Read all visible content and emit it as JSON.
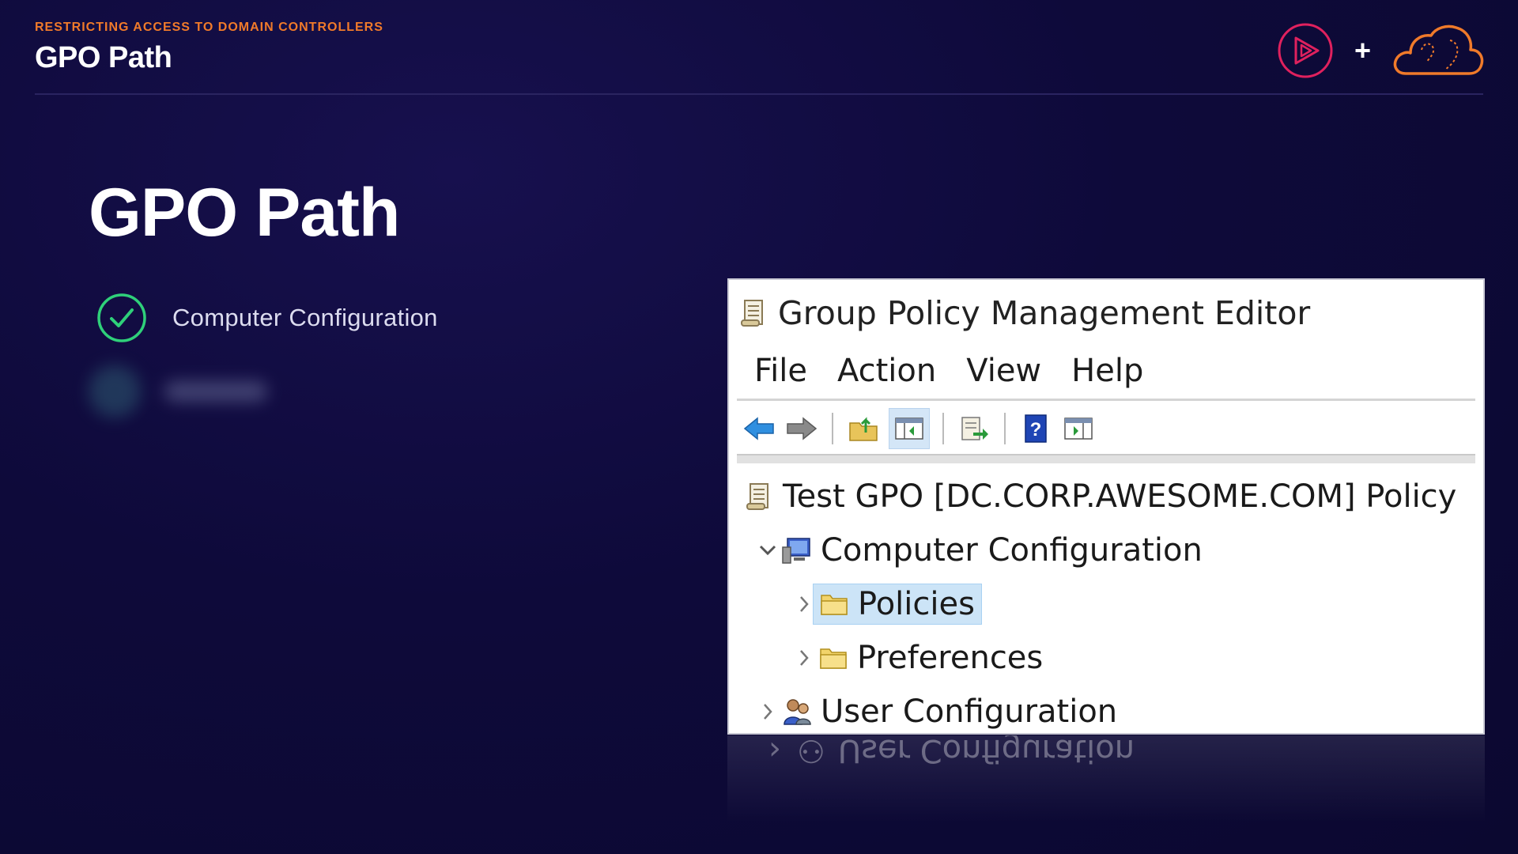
{
  "header": {
    "eyebrow": "RESTRICTING ACCESS TO DOMAIN CONTROLLERS",
    "title": "GPO Path"
  },
  "logos": {
    "left": "play-logo-icon",
    "plus": "+",
    "right": "cloud-logo-icon"
  },
  "main": {
    "title": "GPO Path",
    "bullets": [
      {
        "label": "Computer Configuration",
        "icon": "checkmark-icon",
        "state": "done"
      }
    ]
  },
  "window": {
    "title": "Group Policy Management Editor",
    "menu": [
      "File",
      "Action",
      "View",
      "Help"
    ],
    "toolbar_icons": [
      "back-arrow-icon",
      "forward-arrow-icon",
      "up-folder-icon",
      "show-hide-tree-icon",
      "export-list-icon",
      "help-icon",
      "properties-icon"
    ],
    "tree": {
      "root": "Test GPO [DC.CORP.AWESOME.COM] Policy",
      "computer": "Computer Configuration",
      "policies": "Policies",
      "preferences": "Preferences",
      "user": "User Configuration"
    }
  },
  "reflection": "User Configuration",
  "colors": {
    "accent": "#f07a2a",
    "check": "#2fd07a",
    "brand": "#e0215e",
    "selection": "#cce4f7"
  }
}
